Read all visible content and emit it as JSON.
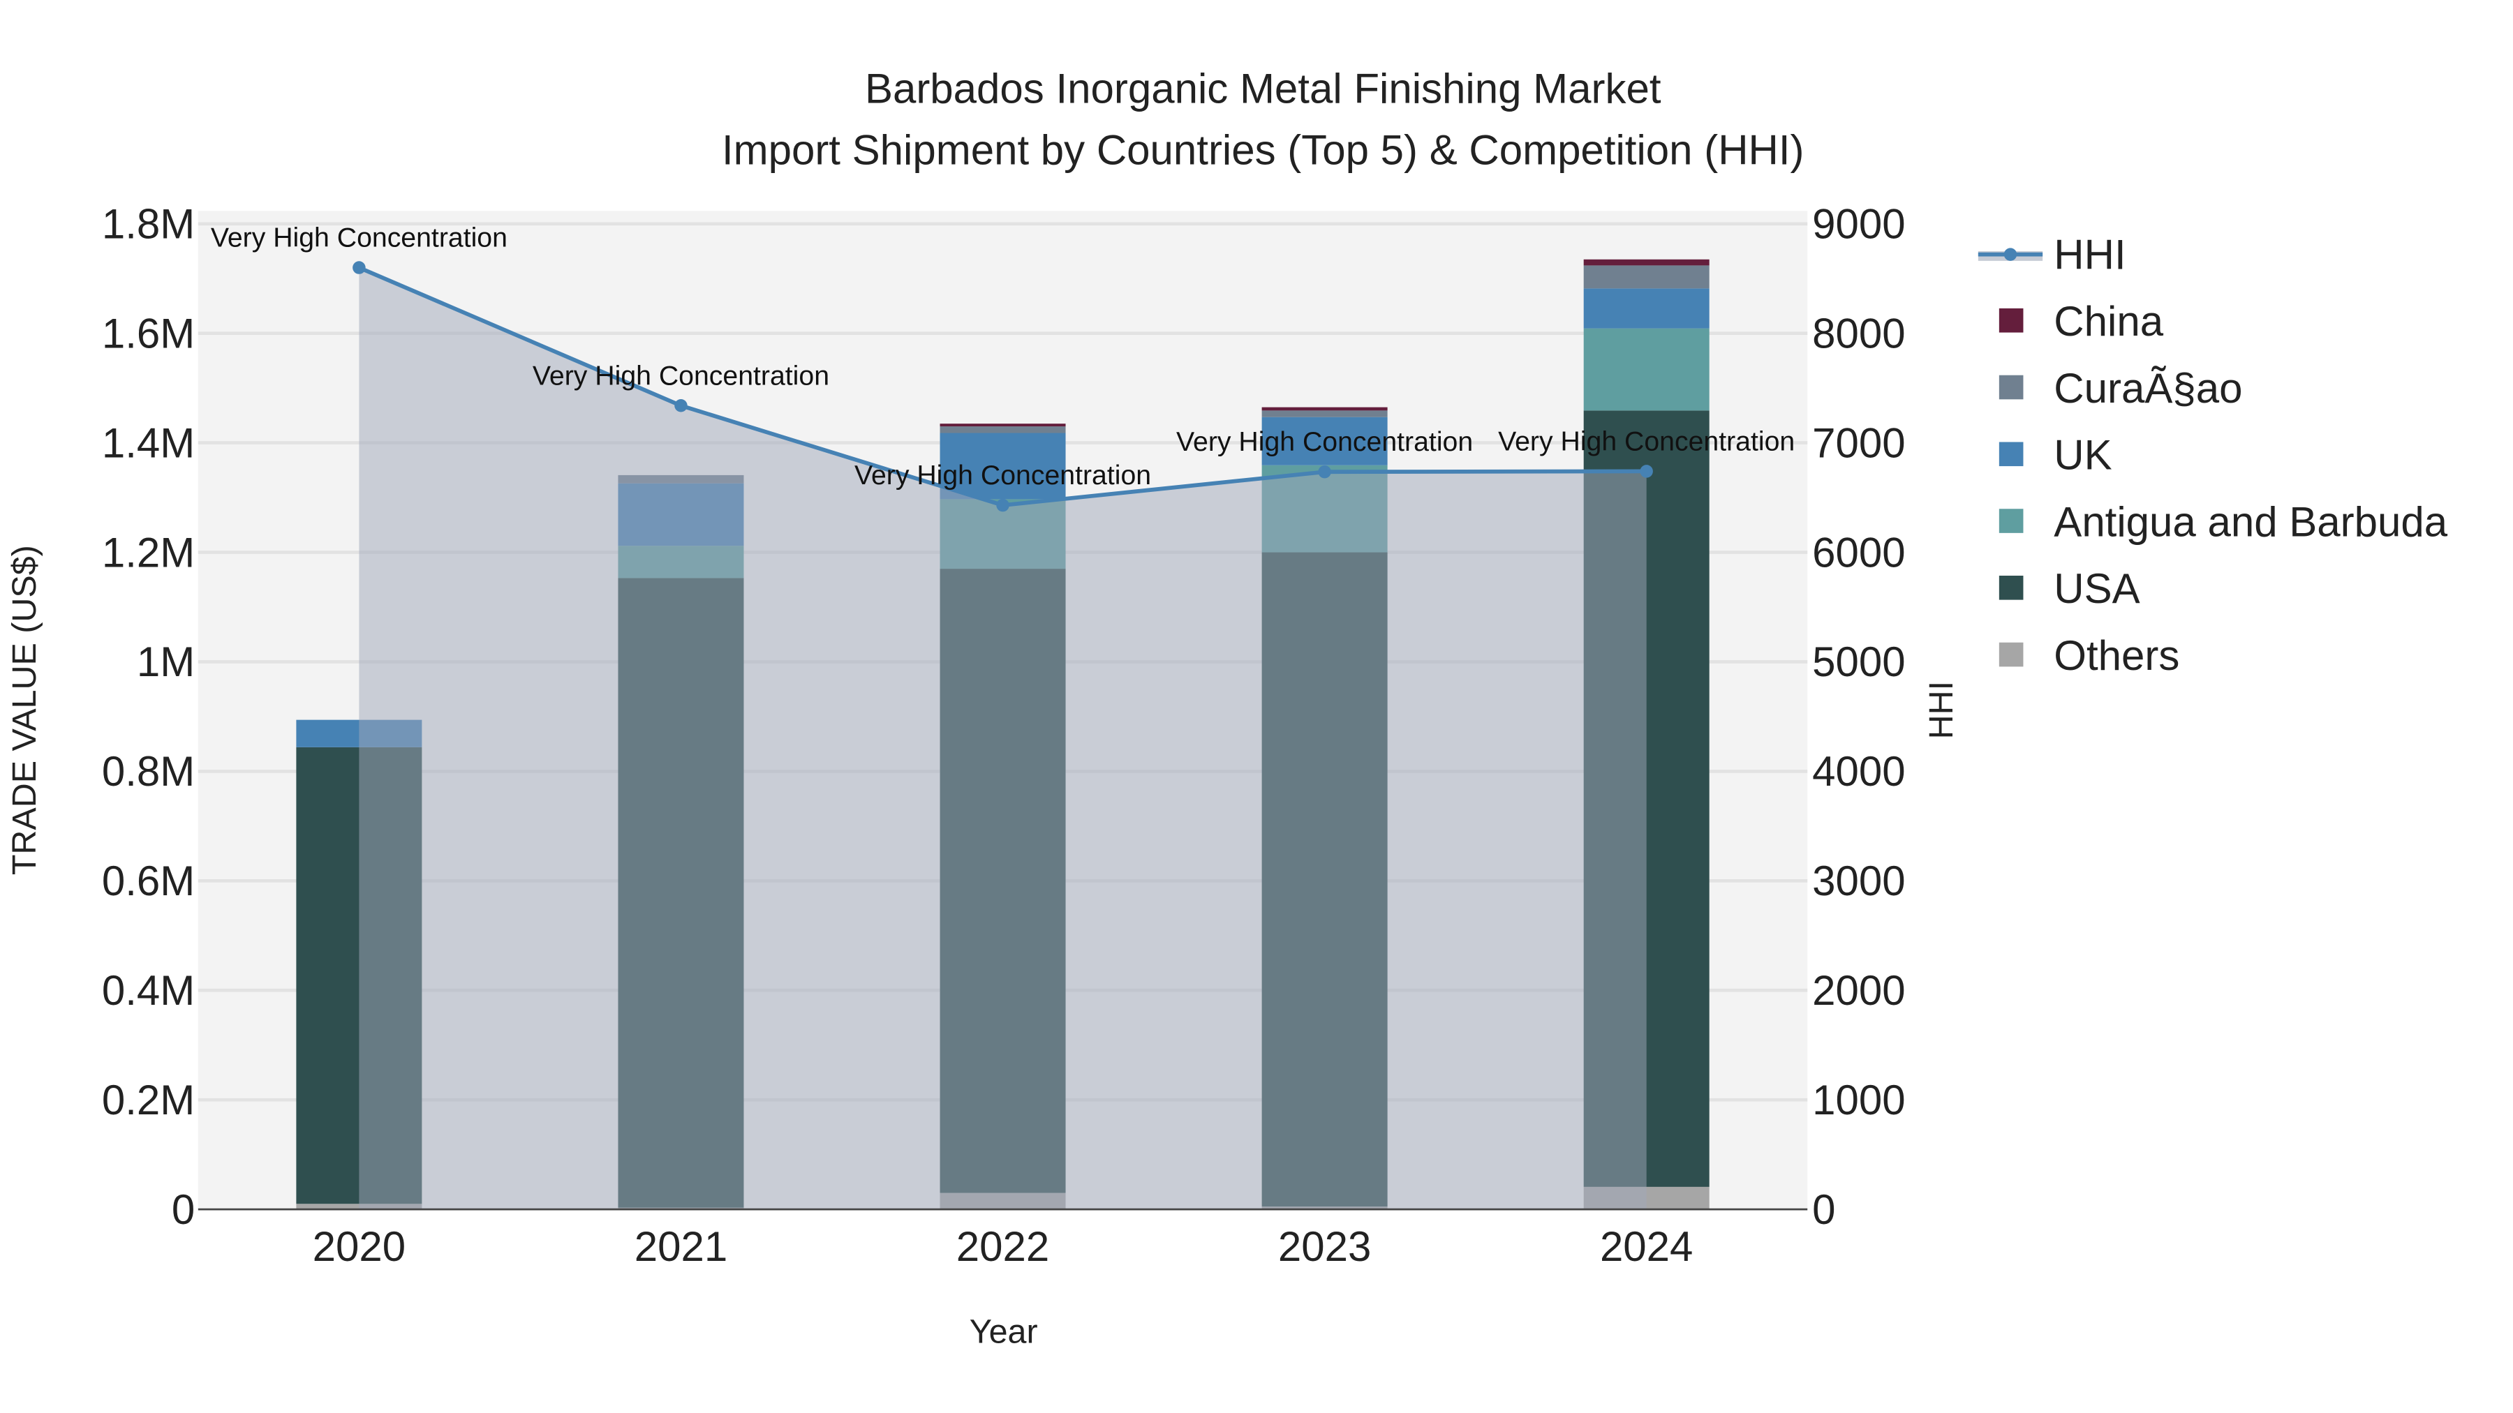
{
  "chart_data": {
    "type": "bar",
    "title_line1": "Barbados Inorganic Metal Finishing Market",
    "title_line2": "Import Shipment by Countries (Top 5) & Competition (HHI)",
    "xlabel": "Year",
    "ylabel": "TRADE VALUE (US$)",
    "y2label": "HHI",
    "categories": [
      "2020",
      "2021",
      "2022",
      "2023",
      "2024"
    ],
    "ylim": [
      0,
      1800000
    ],
    "y2lim": [
      0,
      9000
    ],
    "yticks": [
      {
        "v": 0,
        "label": "0"
      },
      {
        "v": 200000,
        "label": "0.2M"
      },
      {
        "v": 400000,
        "label": "0.4M"
      },
      {
        "v": 600000,
        "label": "0.6M"
      },
      {
        "v": 800000,
        "label": "0.8M"
      },
      {
        "v": 1000000,
        "label": "1M"
      },
      {
        "v": 1200000,
        "label": "1.2M"
      },
      {
        "v": 1400000,
        "label": "1.4M"
      },
      {
        "v": 1600000,
        "label": "1.6M"
      },
      {
        "v": 1800000,
        "label": "1.8M"
      }
    ],
    "y2ticks": [
      "0",
      "1000",
      "2000",
      "3000",
      "4000",
      "5000",
      "6000",
      "7000",
      "8000",
      "9000"
    ],
    "series": [
      {
        "name": "Others",
        "color": "#a6a6a6",
        "values": [
          10000,
          3000,
          30000,
          5000,
          41000
        ]
      },
      {
        "name": "USA",
        "color": "#2f4f4f",
        "values": [
          834000,
          1150000,
          1140000,
          1195000,
          1418000
        ]
      },
      {
        "name": "Antigua and Barbuda",
        "color": "#5f9ea0",
        "values": [
          0,
          59000,
          127000,
          159000,
          150000
        ]
      },
      {
        "name": "UK",
        "color": "#4682b4",
        "values": [
          50000,
          114000,
          121000,
          88000,
          73000
        ]
      },
      {
        "name": "CuraÃ§ao",
        "color": "#708090",
        "values": [
          0,
          15000,
          12000,
          12000,
          42000
        ]
      },
      {
        "name": "China",
        "color": "#641e3c",
        "values": [
          0,
          0,
          5000,
          6000,
          11000
        ]
      }
    ],
    "hhi": {
      "name": "HHI",
      "color": "#4682b4",
      "values": [
        8600,
        7340,
        6430,
        6735,
        6740
      ],
      "annotations": [
        "Very High Concentration",
        "Very High Concentration",
        "Very High Concentration",
        "Very High Concentration",
        "Very High Concentration"
      ]
    },
    "legend": {
      "placement": "right",
      "order": [
        "HHI",
        "China",
        "CuraÃ§ao",
        "UK",
        "Antigua and Barbuda",
        "USA",
        "Others"
      ]
    },
    "grid": true
  }
}
